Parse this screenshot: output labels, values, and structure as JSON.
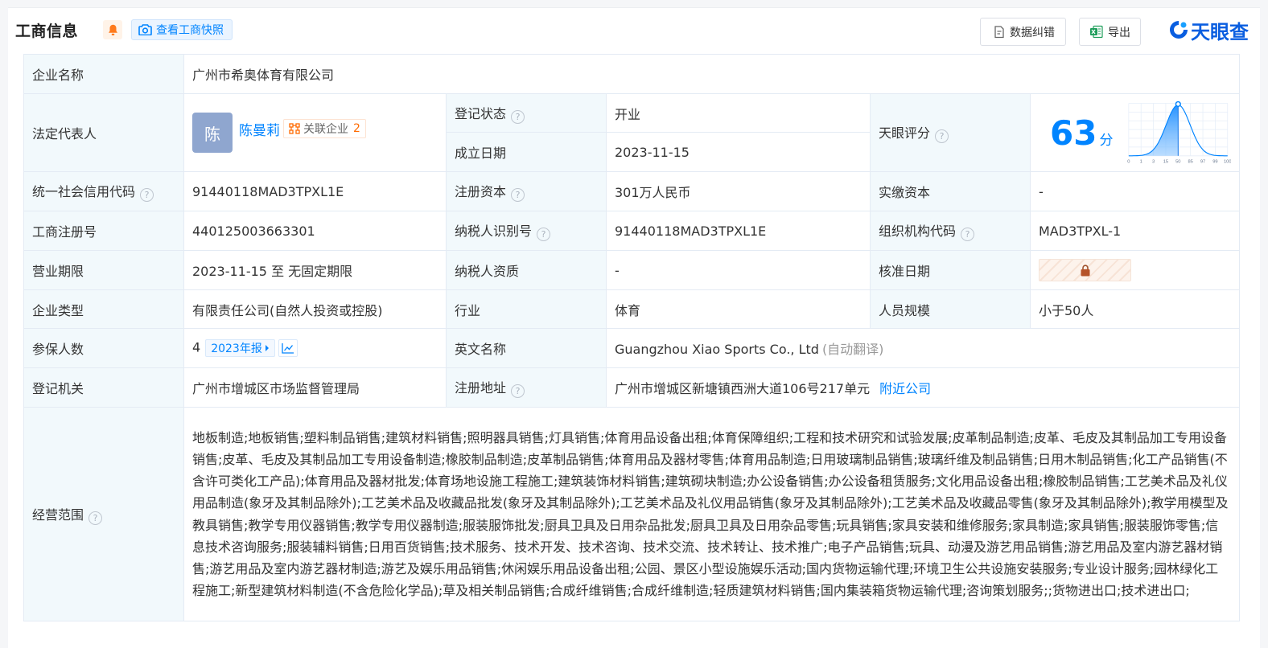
{
  "header": {
    "title": "工商信息",
    "snapshot_label": "查看工商快照",
    "correct_label": "数据纠错",
    "export_label": "导出",
    "logo_text": "天眼查"
  },
  "company": {
    "name_label": "企业名称",
    "name": "广州市希奥体育有限公司"
  },
  "legal_rep": {
    "label": "法定代表人",
    "avatar_char": "陈",
    "name": "陈曼莉",
    "related_label": "关联企业",
    "related_count": "2"
  },
  "status": {
    "label": "登记状态",
    "value": "开业"
  },
  "founded": {
    "label": "成立日期",
    "value": "2023-11-15"
  },
  "score": {
    "label": "天眼评分",
    "value": "63",
    "unit": "分",
    "chart_ticks": [
      "0",
      "1",
      "3",
      "15",
      "50",
      "85",
      "97",
      "99",
      "100"
    ],
    "marker_percent": 50
  },
  "credit_code": {
    "label": "统一社会信用代码",
    "value": "91440118MAD3TPXL1E"
  },
  "reg_capital": {
    "label": "注册资本",
    "value": "301万人民币"
  },
  "paid_capital": {
    "label": "实缴资本",
    "value": "-"
  },
  "reg_no": {
    "label": "工商注册号",
    "value": "440125003663301"
  },
  "taxpayer_id": {
    "label": "纳税人识别号",
    "value": "91440118MAD3TPXL1E"
  },
  "org_code": {
    "label": "组织机构代码",
    "value": "MAD3TPXL-1"
  },
  "term": {
    "label": "营业期限",
    "value": "2023-11-15 至 无固定期限"
  },
  "tax_qual": {
    "label": "纳税人资质",
    "value": "-"
  },
  "approve_date": {
    "label": "核准日期"
  },
  "type": {
    "label": "企业类型",
    "value": "有限责任公司(自然人投资或控股)"
  },
  "industry": {
    "label": "行业",
    "value": "体育"
  },
  "staff": {
    "label": "人员规模",
    "value": "小于50人"
  },
  "insured": {
    "label": "参保人数",
    "value": "4",
    "report_label": "2023年报"
  },
  "english": {
    "label": "英文名称",
    "value": "Guangzhou Xiao Sports Co., Ltd",
    "note": "(自动翻译)"
  },
  "authority": {
    "label": "登记机关",
    "value": "广州市增城区市场监督管理局"
  },
  "address": {
    "label": "注册地址",
    "value": "广州市增城区新塘镇西洲大道106号217单元",
    "nearby_label": "附近公司"
  },
  "scope": {
    "label": "经营范围",
    "value": "地板制造;地板销售;塑料制品销售;建筑材料销售;照明器具销售;灯具销售;体育用品设备出租;体育保障组织;工程和技术研究和试验发展;皮革制品制造;皮革、毛皮及其制品加工专用设备销售;皮革、毛皮及其制品加工专用设备制造;橡胶制品制造;皮革制品销售;体育用品及器材零售;体育用品制造;日用玻璃制品销售;玻璃纤维及制品销售;日用木制品销售;化工产品销售(不含许可类化工产品);体育用品及器材批发;体育场地设施工程施工;建筑装饰材料销售;建筑砌块制造;办公设备销售;办公设备租赁服务;文化用品设备出租;橡胶制品销售;工艺美术品及礼仪用品制造(象牙及其制品除外);工艺美术品及收藏品批发(象牙及其制品除外);工艺美术品及礼仪用品销售(象牙及其制品除外);工艺美术品及收藏品零售(象牙及其制品除外);教学用模型及教具销售;教学专用仪器销售;教学专用仪器制造;服装服饰批发;厨具卫具及日用杂品批发;厨具卫具及日用杂品零售;玩具销售;家具安装和维修服务;家具制造;家具销售;服装服饰零售;信息技术咨询服务;服装辅料销售;日用百货销售;技术服务、技术开发、技术咨询、技术交流、技术转让、技术推广;电子产品销售;玩具、动漫及游艺用品销售;游艺用品及室内游艺器材销售;游艺用品及室内游艺器材制造;游艺及娱乐用品销售;休闲娱乐用品设备出租;公园、景区小型设施娱乐活动;国内货物运输代理;环境卫生公共设施安装服务;专业设计服务;园林绿化工程施工;新型建筑材料制造(不含危险化学品);草及相关制品销售;合成纤维销售;合成纤维制造;轻质建筑材料销售;国内集装箱货物运输代理;咨询策划服务;;货物进出口;技术进出口;"
  }
}
